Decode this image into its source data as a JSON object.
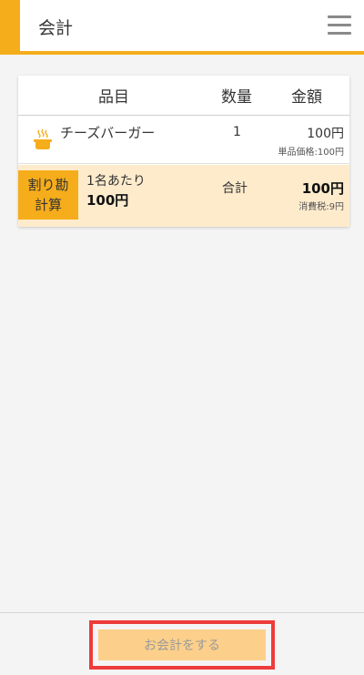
{
  "header": {
    "title": "会計",
    "menu_icon": "hamburger-menu-icon"
  },
  "table": {
    "columns": [
      "品目",
      "数量",
      "金額"
    ],
    "items": [
      {
        "icon": "cooking-pot-icon",
        "name": "チーズバーガー",
        "qty": "1",
        "price": "100円",
        "unit_price": "単品価格:100円"
      }
    ]
  },
  "split": {
    "label_line1": "割り勘",
    "label_line2": "計算",
    "per_person_label": "1名あたり",
    "per_person_amount": "100円",
    "total_label": "合計",
    "total_amount": "100円",
    "tax": "消費税:9円"
  },
  "footer": {
    "checkout_label": "お会計をする"
  },
  "colors": {
    "accent": "#f6ad1b",
    "split_bg": "#fdebcc",
    "button_bg": "#fcd08a",
    "highlight": "#ee3b3b"
  }
}
